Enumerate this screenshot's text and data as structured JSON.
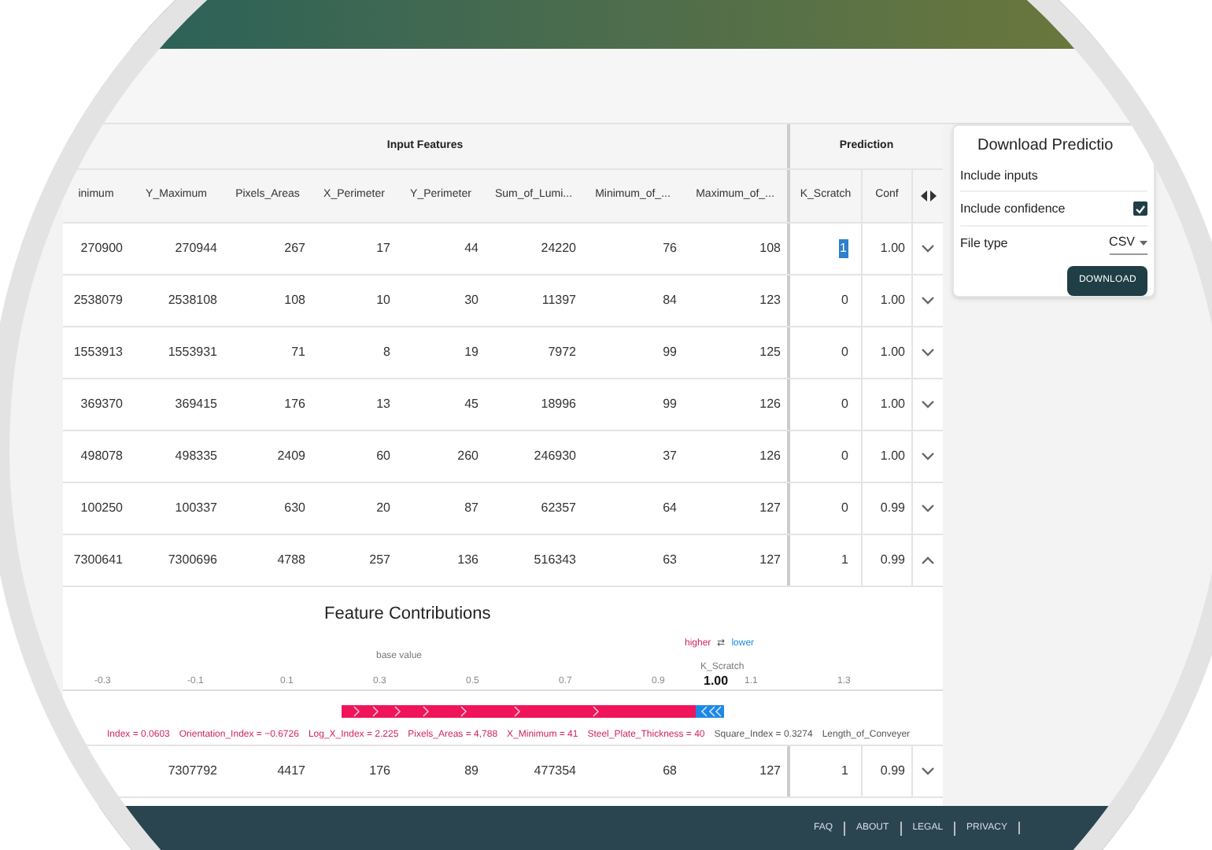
{
  "table": {
    "group_headers": [
      "Input Features",
      "Prediction"
    ],
    "columns": [
      "inimum",
      "Y_Maximum",
      "Pixels_Areas",
      "X_Perimeter",
      "Y_Perimeter",
      "Sum_of_Lumi...",
      "Minimum_of_...",
      "Maximum_of_..."
    ],
    "prediction_columns": [
      "K_Scratch",
      "Conf"
    ],
    "rows": [
      {
        "cells": [
          "270900",
          "270944",
          "267",
          "17",
          "44",
          "24220",
          "76",
          "108"
        ],
        "k_scratch": "1",
        "k_selected": true,
        "conf": "1.00",
        "expanded": false
      },
      {
        "cells": [
          "2538079",
          "2538108",
          "108",
          "10",
          "30",
          "11397",
          "84",
          "123"
        ],
        "k_scratch": "0",
        "k_selected": false,
        "conf": "1.00",
        "expanded": false
      },
      {
        "cells": [
          "1553913",
          "1553931",
          "71",
          "8",
          "19",
          "7972",
          "99",
          "125"
        ],
        "k_scratch": "0",
        "k_selected": false,
        "conf": "1.00",
        "expanded": false
      },
      {
        "cells": [
          "369370",
          "369415",
          "176",
          "13",
          "45",
          "18996",
          "99",
          "126"
        ],
        "k_scratch": "0",
        "k_selected": false,
        "conf": "1.00",
        "expanded": false
      },
      {
        "cells": [
          "498078",
          "498335",
          "2409",
          "60",
          "260",
          "246930",
          "37",
          "126"
        ],
        "k_scratch": "0",
        "k_selected": false,
        "conf": "1.00",
        "expanded": false
      },
      {
        "cells": [
          "100250",
          "100337",
          "630",
          "20",
          "87",
          "62357",
          "64",
          "127"
        ],
        "k_scratch": "0",
        "k_selected": false,
        "conf": "0.99",
        "expanded": false
      },
      {
        "cells": [
          "7300641",
          "7300696",
          "4788",
          "257",
          "136",
          "516343",
          "63",
          "127"
        ],
        "k_scratch": "1",
        "k_selected": false,
        "conf": "0.99",
        "expanded": true
      },
      {
        "cells": [
          "",
          "7307792",
          "4417",
          "176",
          "89",
          "477354",
          "68",
          "127"
        ],
        "k_scratch": "1",
        "k_selected": false,
        "conf": "0.99",
        "expanded": false
      }
    ]
  },
  "contributions": {
    "title": "Feature Contributions",
    "higher": "higher",
    "swap": "⇄",
    "lower": "lower",
    "base_label": "base value",
    "output_name": "K_Scratch",
    "output_value": "1.00",
    "ticks": [
      "-0.3",
      "-0.1",
      "0.1",
      "0.3",
      "0.5",
      "0.7",
      "0.9",
      "1.1",
      "1.3"
    ],
    "features": [
      "Index = 0.0603",
      "Orientation_Index = −0.6726",
      "Log_X_Index = 2.225",
      "Pixels_Areas = 4,788",
      "X_Minimum = 41",
      "Steel_Plate_Thickness = 40",
      "Square_Index = 0.3274",
      "Length_of_Conveyer"
    ]
  },
  "download": {
    "title": "Download Predictio",
    "include_inputs": "Include inputs",
    "include_confidence": "Include confidence",
    "confidence_checked": true,
    "file_type_label": "File type",
    "file_type": "CSV",
    "button": "DOWNLOAD"
  },
  "footer": {
    "links": [
      "FAQ",
      "ABOUT",
      "LEGAL",
      "PRIVACY"
    ]
  }
}
